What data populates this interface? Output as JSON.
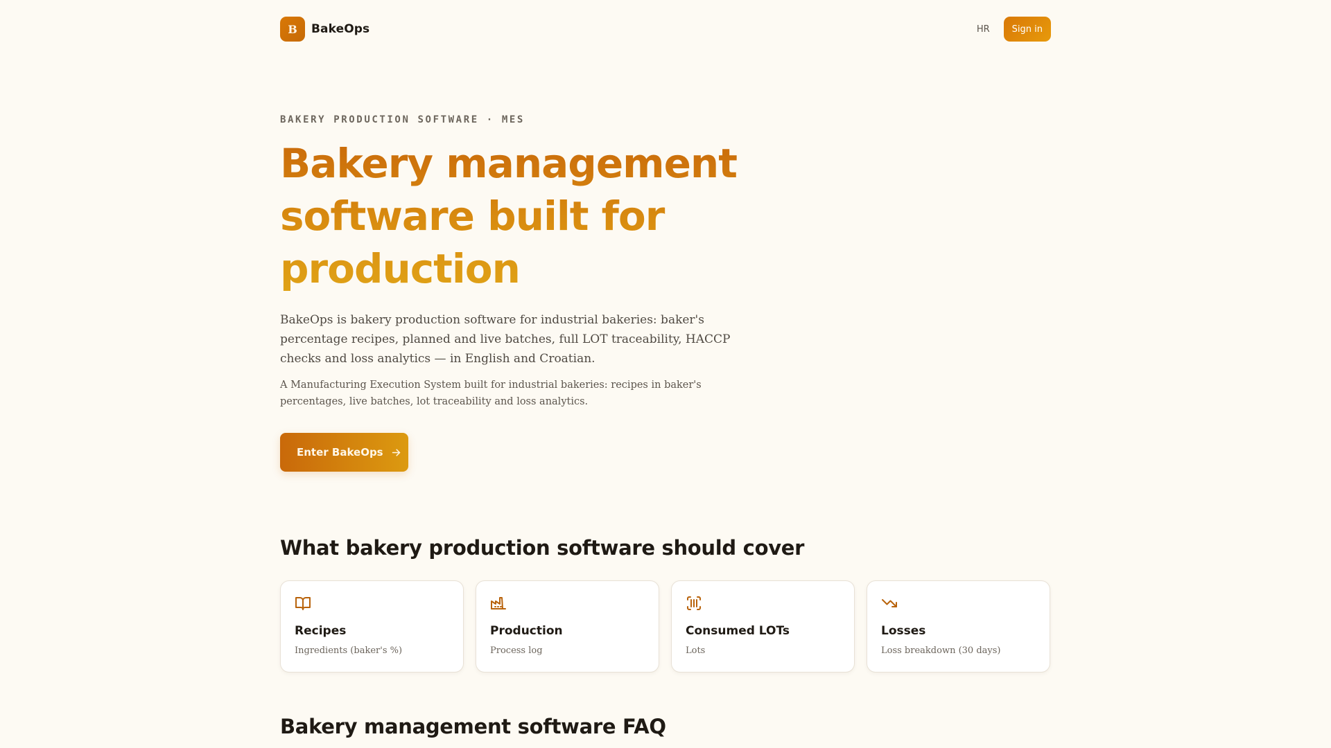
{
  "brand": {
    "badge_letter": "B",
    "name": "BakeOps"
  },
  "header": {
    "lang_label": "HR",
    "signin_label": "Sign in"
  },
  "hero": {
    "eyebrow": "BAKERY PRODUCTION SOFTWARE · MES",
    "title": "Bakery management software built for production",
    "lead": "BakeOps is bakery production software for industrial bakeries: baker's percentage recipes, planned and live batches, full LOT traceability, HACCP checks and loss analytics — in English and Croatian.",
    "sublead": "A Manufacturing Execution System built for industrial bakeries: recipes in baker's percentages, live batches, lot traceability and loss analytics.",
    "cta_label": "Enter BakeOps"
  },
  "features": {
    "title": "What bakery production software should cover",
    "cards": [
      {
        "icon": "book-open-icon",
        "title": "Recipes",
        "subtitle": "Ingredients (baker's %)"
      },
      {
        "icon": "factory-icon",
        "title": "Production",
        "subtitle": "Process log"
      },
      {
        "icon": "scan-barcode-icon",
        "title": "Consumed LOTs",
        "subtitle": "Lots"
      },
      {
        "icon": "trending-down-icon",
        "title": "Losses",
        "subtitle": "Loss breakdown (30 days)"
      }
    ]
  },
  "faq": {
    "title": "Bakery management software FAQ"
  },
  "colors": {
    "accent": "#c9690a",
    "accent_light": "#e0a317",
    "background": "#fdfaf3"
  }
}
